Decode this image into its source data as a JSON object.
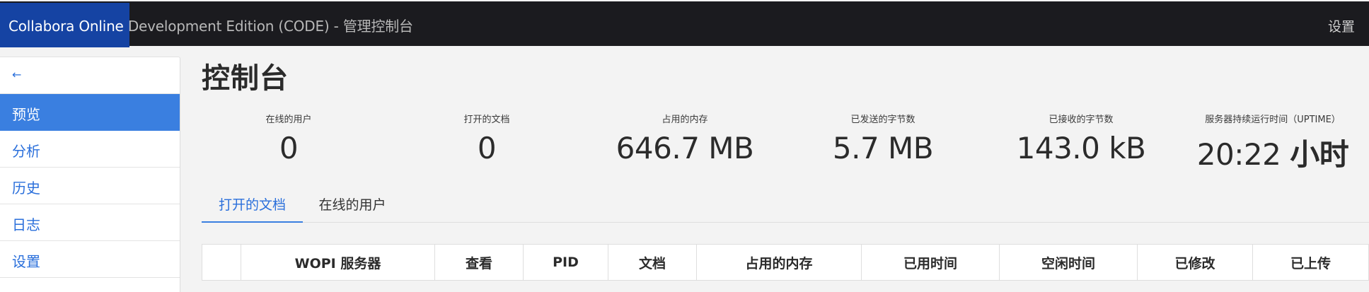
{
  "navbar": {
    "brand": "Collabora Online",
    "title_rest": " Development Edition (CODE) - 管理控制台",
    "settings_label": "设置"
  },
  "sidebar": {
    "back_label": "←",
    "items": [
      {
        "label": "预览",
        "active": true
      },
      {
        "label": "分析",
        "active": false
      },
      {
        "label": "历史",
        "active": false
      },
      {
        "label": "日志",
        "active": false
      },
      {
        "label": "设置",
        "active": false
      }
    ]
  },
  "page": {
    "title": "控制台"
  },
  "stats": [
    {
      "label": "在线的用户",
      "value": "0"
    },
    {
      "label": "打开的文档",
      "value": "0"
    },
    {
      "label": "占用的内存",
      "value": "646.7 MB"
    },
    {
      "label": "已发送的字节数",
      "value": "5.7 MB"
    },
    {
      "label": "已接收的字节数",
      "value": "143.0 kB"
    },
    {
      "label": "服务器持续运行时间（UPTIME）",
      "value": "20:22",
      "unit": "小时"
    }
  ],
  "tabs": [
    {
      "label": "打开的文档",
      "active": true
    },
    {
      "label": "在线的用户",
      "active": false
    }
  ],
  "table": {
    "columns": [
      "",
      "WOPI 服务器",
      "查看",
      "PID",
      "文档",
      "占用的内存",
      "已用时间",
      "空闲时间",
      "已修改",
      "已上传"
    ]
  },
  "colors": {
    "accent": "#3a7fe0",
    "navbar_bg": "#1b1b1f",
    "brand_bg": "#1543a3",
    "link": "#2a6fdb"
  }
}
